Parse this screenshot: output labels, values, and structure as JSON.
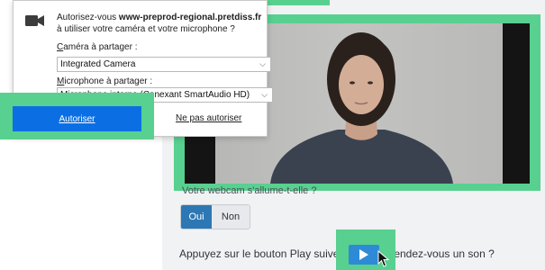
{
  "dialog": {
    "message_prefix": "Autorisez-vous ",
    "site": "www-preprod-regional.pretdiss.fr",
    "message_suffix": " à utiliser votre caméra et votre microphone ?",
    "camera_label_first": "C",
    "camera_label_rest": "améra à partager :",
    "camera_value": "Integrated Camera",
    "mic_label_first": "M",
    "mic_label_rest": "icrophone à partager :",
    "mic_value": "Microphone interne (Conexant SmartAudio HD)",
    "allow_label": "Autoriser",
    "deny_label": "Ne pas autoriser",
    "chevron": "⌵"
  },
  "page": {
    "question_text": "Votre webcam s'allume-t-elle ?",
    "yes_label": "Oui",
    "no_label": "Non",
    "play_text_left": "Appuyez sur le bouton Play suiver",
    "play_text_right": "tendez-vous un son ?"
  },
  "colors": {
    "highlight": "#58d08f",
    "allow_button": "#0b6fe3",
    "yes_button": "#2d78b4",
    "play_button": "#2e8ad6"
  }
}
